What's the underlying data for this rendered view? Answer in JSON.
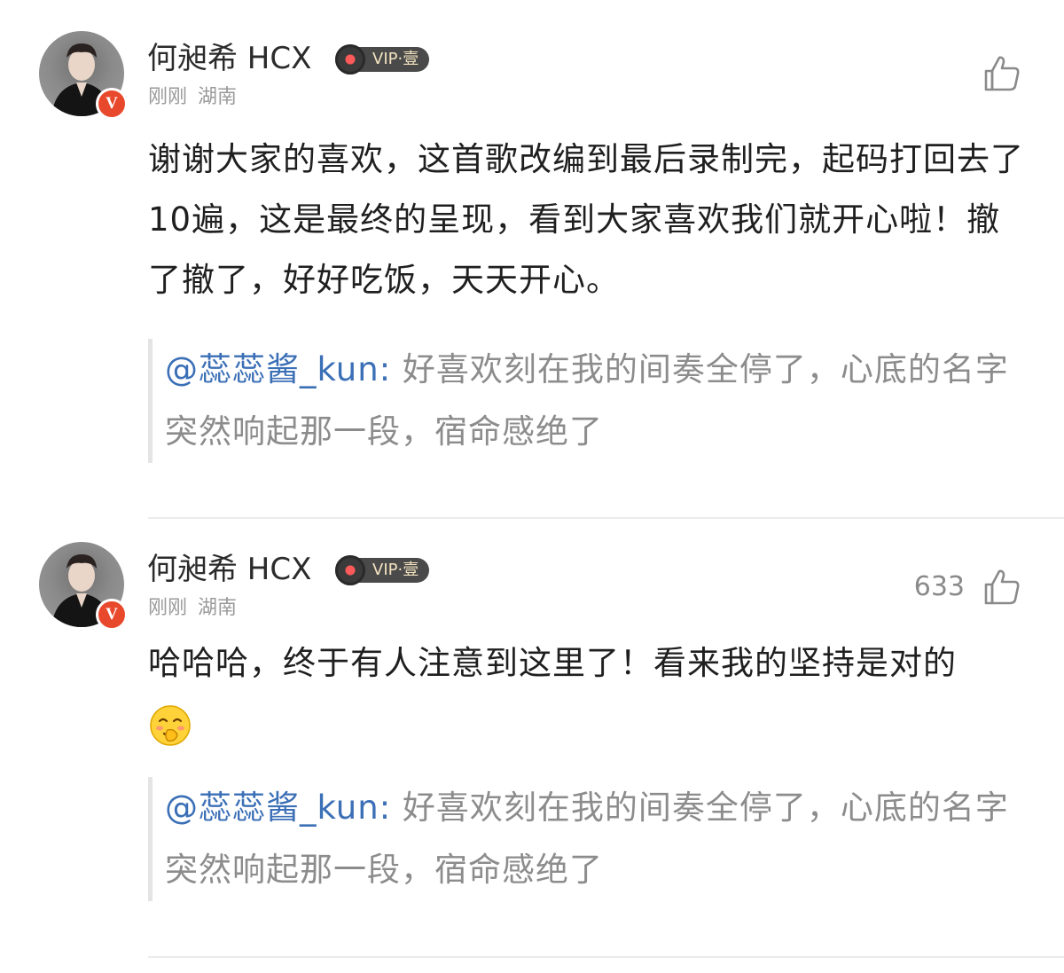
{
  "comments": [
    {
      "username": "何昶希 HCX",
      "vip_label": "VIP·壹",
      "verify_badge": "V",
      "time": "刚刚",
      "location": "湖南",
      "like_count": "",
      "text": "谢谢大家的喜欢，这首歌改编到最后录制完，起码打回去了10遍，这是最终的呈现，看到大家喜欢我们就开心啦！撤了撤了，好好吃饭，天天开心。",
      "emoji": "",
      "quote": {
        "mention": "@蕊蕊酱_kun:",
        "text": " 好喜欢刻在我的间奏全停了，心底的名字突然响起那一段，宿命感绝了"
      }
    },
    {
      "username": "何昶希 HCX",
      "vip_label": "VIP·壹",
      "verify_badge": "V",
      "time": "刚刚",
      "location": "湖南",
      "like_count": "633",
      "text": "哈哈哈，终于有人注意到这里了！看来我的坚持是对的",
      "emoji": "shy-laugh-emoji",
      "quote": {
        "mention": "@蕊蕊酱_kun:",
        "text": " 好喜欢刻在我的间奏全停了，心底的名字突然响起那一段，宿命感绝了"
      }
    }
  ],
  "colors": {
    "mention": "#3b6fb6",
    "verify_badge": "#e8482c",
    "meta_text": "#9a9a9a",
    "quote_text": "#8c8c8c"
  }
}
